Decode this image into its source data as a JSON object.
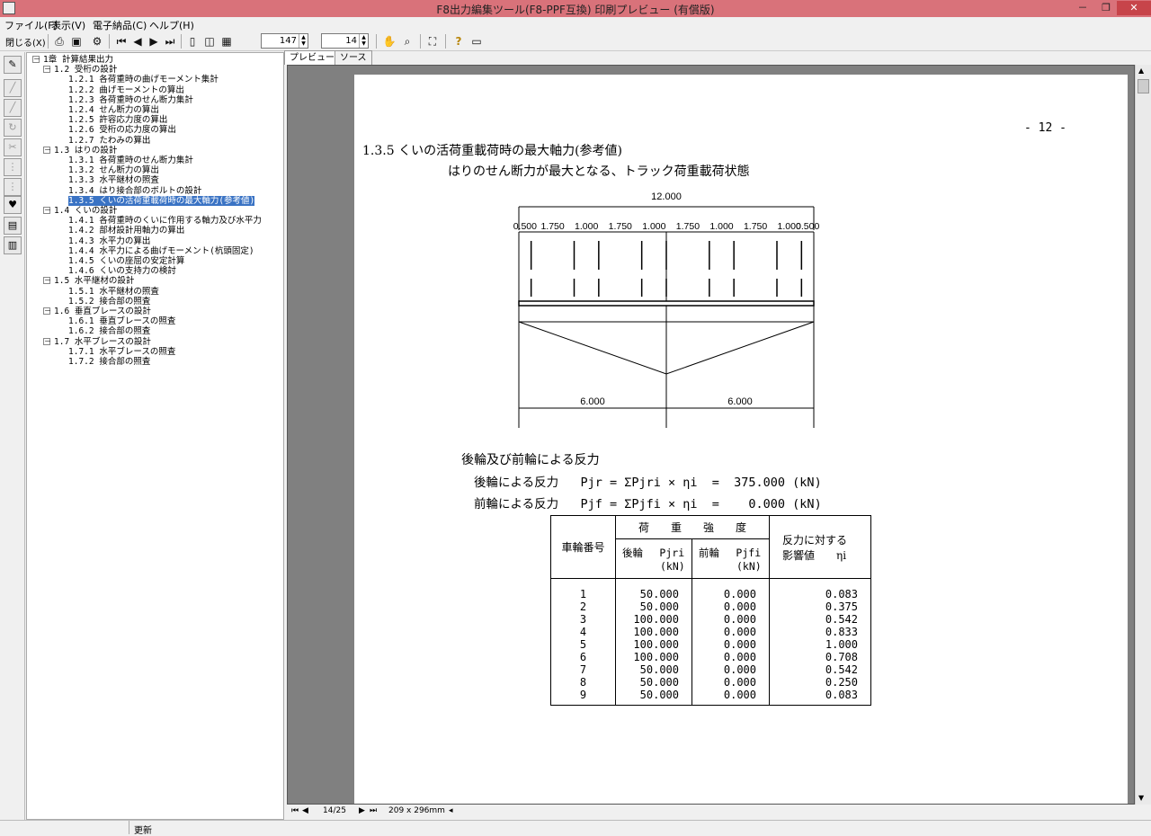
{
  "window": {
    "title": "F8出力編集ツール(F8-PPF互換) 印刷プレビュー (有償版)",
    "min": "－",
    "max": "❐",
    "close": "✕"
  },
  "menu": [
    "ファイル(F)",
    "表示(V)",
    "電子納品(C)",
    "ヘルプ(H)"
  ],
  "toolbar": {
    "close_label": "閉じる(X)",
    "page_value": "147",
    "zoom_value": "14"
  },
  "tabs": [
    "プレビュー",
    "ソース"
  ],
  "tree": [
    {
      "label": "1章 計算結果出力",
      "level": 0,
      "box": "－"
    },
    {
      "label": "1.2 受桁の設計",
      "level": 1,
      "box": "－"
    },
    {
      "label": "1.2.1 各荷重時の曲げモーメント集計",
      "level": 2
    },
    {
      "label": "1.2.2 曲げモーメントの算出",
      "level": 2
    },
    {
      "label": "1.2.3 各荷重時のせん断力集計",
      "level": 2
    },
    {
      "label": "1.2.4 せん断力の算出",
      "level": 2
    },
    {
      "label": "1.2.5 許容応力度の算出",
      "level": 2
    },
    {
      "label": "1.2.6 受桁の応力度の算出",
      "level": 2
    },
    {
      "label": "1.2.7 たわみの算出",
      "level": 2
    },
    {
      "label": "1.3 はりの設計",
      "level": 1,
      "box": "－"
    },
    {
      "label": "1.3.1 各荷重時のせん断力集計",
      "level": 2
    },
    {
      "label": "1.3.2 せん断力の算出",
      "level": 2
    },
    {
      "label": "1.3.3 水平継材の照査",
      "level": 2
    },
    {
      "label": "1.3.4 はり接合部のボルトの設計",
      "level": 2
    },
    {
      "label": "1.3.5 くいの活荷重載荷時の最大軸力(参考値)",
      "level": 2,
      "selected": true
    },
    {
      "label": "1.4 くいの設計",
      "level": 1,
      "box": "－"
    },
    {
      "label": "1.4.1 各荷重時のくいに作用する軸力及び水平力",
      "level": 2
    },
    {
      "label": "1.4.2 部材設計用軸力の算出",
      "level": 2
    },
    {
      "label": "1.4.3 水平力の算出",
      "level": 2
    },
    {
      "label": "1.4.4 水平力による曲げモーメント(杭頭固定)",
      "level": 2
    },
    {
      "label": "1.4.5 くいの座屈の安定計算",
      "level": 2
    },
    {
      "label": "1.4.6 くいの支持力の検討",
      "level": 2
    },
    {
      "label": "1.5 水平継材の設計",
      "level": 1,
      "box": "－"
    },
    {
      "label": "1.5.1 水平継材の照査",
      "level": 2
    },
    {
      "label": "1.5.2 接合部の照査",
      "level": 2
    },
    {
      "label": "1.6 垂直ブレースの設計",
      "level": 1,
      "box": "－"
    },
    {
      "label": "1.6.1 垂直ブレースの照査",
      "level": 2
    },
    {
      "label": "1.6.2 接合部の照査",
      "level": 2
    },
    {
      "label": "1.7 水平ブレースの設計",
      "level": 1,
      "box": "－"
    },
    {
      "label": "1.7.1 水平ブレースの照査",
      "level": 2
    },
    {
      "label": "1.7.2 接合部の照査",
      "level": 2
    }
  ],
  "page": {
    "page_no": "- 12 -",
    "heading": "1.3.5 くいの活荷重載荷時の最大軸力(参考値)",
    "subheading": "はりのせん断力が最大となる、トラック荷重載荷状態",
    "total_span": "12.000",
    "spacings": [
      "0.500",
      "1.750",
      "1.000",
      "1.750",
      "1.000",
      "1.750",
      "1.000",
      "1.750",
      "1.000",
      "0.500"
    ],
    "half_spans": [
      "6.000",
      "6.000"
    ],
    "reaction_title": "後輪及び前輪による反力",
    "rear_line": "後輪による反力   Pjr = ΣPjri × ηi  =  375.000 (kN)",
    "front_line": "前輪による反力   Pjf = ΣPjfi × ηi  =    0.000 (kN)",
    "table": {
      "h_wheel": "車輪番号",
      "h_load": "荷　　重　　強　　度",
      "h_rear": "後輪　 Pjri",
      "h_rear_unit": "(kN)",
      "h_front": "前輪　 Pjfi",
      "h_front_unit": "(kN)",
      "h_infl1": "反力に対する",
      "h_infl2": "影響値　　ηi",
      "rows": [
        [
          "1",
          "50.000",
          "0.000",
          "0.083"
        ],
        [
          "2",
          "50.000",
          "0.000",
          "0.375"
        ],
        [
          "3",
          "100.000",
          "0.000",
          "0.542"
        ],
        [
          "4",
          "100.000",
          "0.000",
          "0.833"
        ],
        [
          "5",
          "100.000",
          "0.000",
          "1.000"
        ],
        [
          "6",
          "100.000",
          "0.000",
          "0.708"
        ],
        [
          "7",
          "50.000",
          "0.000",
          "0.542"
        ],
        [
          "8",
          "50.000",
          "0.000",
          "0.250"
        ],
        [
          "9",
          "50.000",
          "0.000",
          "0.083"
        ]
      ]
    }
  },
  "nav": {
    "page_label": "14/25",
    "paper_size": "209 x 296mm"
  },
  "status": {
    "text": "更新"
  }
}
